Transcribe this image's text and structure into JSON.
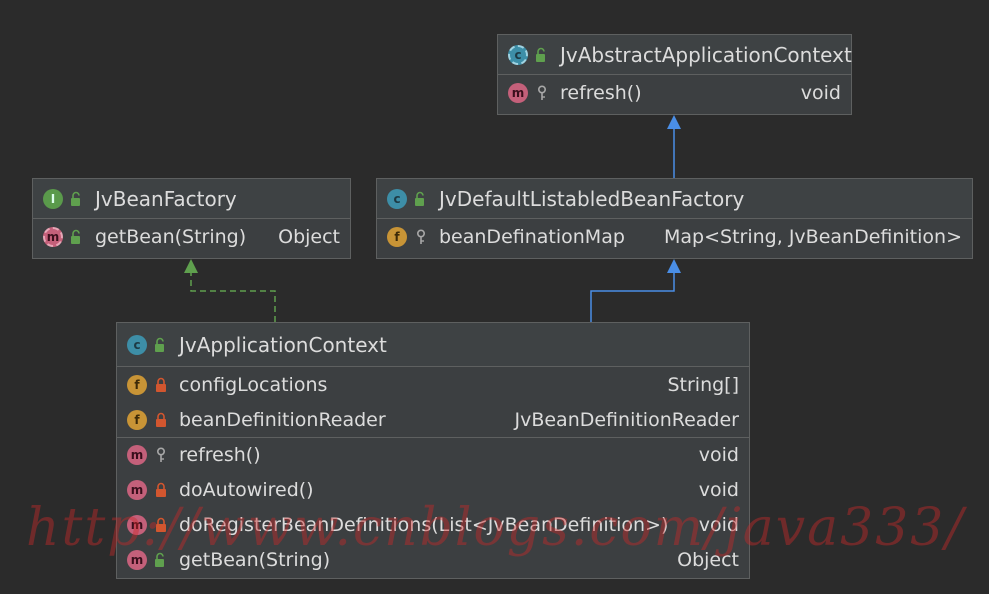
{
  "classes": {
    "abstract_context": {
      "name": "JvAbstractApplicationContext",
      "members": [
        {
          "name": "refresh()",
          "type": "void"
        }
      ]
    },
    "bean_factory": {
      "name": "JvBeanFactory",
      "members": [
        {
          "name": "getBean(String)",
          "type": "Object"
        }
      ]
    },
    "default_factory": {
      "name": "JvDefaultListabledBeanFactory",
      "members": [
        {
          "name": "beanDefinationMap",
          "type": "Map<String, JvBeanDefinition>"
        }
      ]
    },
    "application_context": {
      "name": "JvApplicationContext",
      "fields": [
        {
          "name": "configLocations",
          "type": "String[]"
        },
        {
          "name": "beanDefinitionReader",
          "type": "JvBeanDefinitionReader"
        }
      ],
      "methods": [
        {
          "name": "refresh()",
          "type": "void"
        },
        {
          "name": "doAutowired()",
          "type": "void"
        },
        {
          "name": "doRegisterBeanDefinitions(List<JvBeanDefinition>)",
          "type": "void"
        },
        {
          "name": "getBean(String)",
          "type": "Object"
        }
      ]
    }
  },
  "badges": {
    "class": "c",
    "interface": "I",
    "field": "f",
    "method": "m"
  },
  "watermark": "http://www.cnblogs.com/java333/",
  "colors": {
    "background": "#2b2b2b",
    "box": "#3c3f41",
    "border": "#5e6060",
    "extends_arrow": "#4a8ee6",
    "implements_arrow": "#5fa04e",
    "watermark": "#cd2828"
  }
}
